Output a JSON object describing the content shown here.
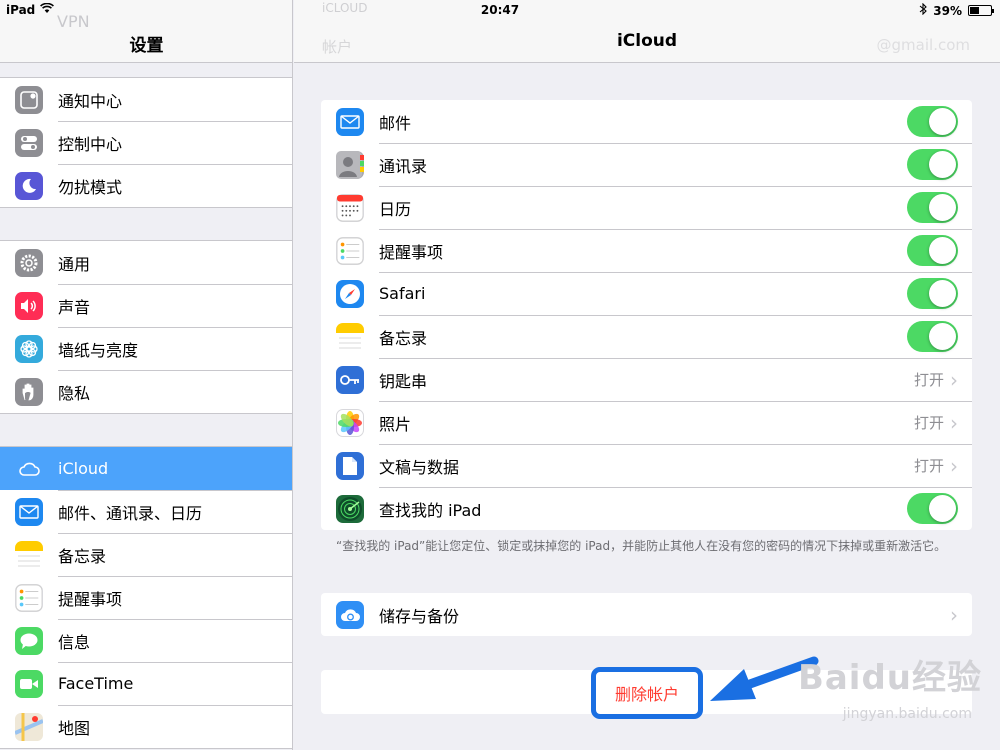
{
  "status_bar": {
    "device": "iPad",
    "time": "20:47",
    "battery": "39%",
    "battery_fraction": 0.39
  },
  "left_pane": {
    "title": "设置",
    "ghost_item": "VPN",
    "groups": [
      [
        {
          "label": "通知中心",
          "icon": "notification-center-icon",
          "color": "#8e8e93"
        },
        {
          "label": "控制中心",
          "icon": "control-center-icon",
          "color": "#8e8e93"
        },
        {
          "label": "勿扰模式",
          "icon": "moon-icon",
          "color": "#5856d6"
        }
      ],
      [
        {
          "label": "通用",
          "icon": "gear-icon",
          "color": "#8e8e93"
        },
        {
          "label": "声音",
          "icon": "speaker-icon",
          "color": "#ff2d55"
        },
        {
          "label": "墙纸与亮度",
          "icon": "flower-icon",
          "color": "#34aadc"
        },
        {
          "label": "隐私",
          "icon": "hand-icon",
          "color": "#8e8e93"
        }
      ],
      [
        {
          "label": "iCloud",
          "icon": "cloud-icon",
          "color": "#4ca3fb",
          "selected": true
        },
        {
          "label": "邮件、通讯录、日历",
          "icon": "mail-icon",
          "color": "#1e88f0"
        },
        {
          "label": "备忘录",
          "icon": "notes-icon",
          "color": "#ffcc00"
        },
        {
          "label": "提醒事项",
          "icon": "reminders-icon",
          "color": "#ffffff"
        },
        {
          "label": "信息",
          "icon": "messages-icon",
          "color": "#4cd964"
        },
        {
          "label": "FaceTime",
          "icon": "facetime-icon",
          "color": "#4cd964"
        },
        {
          "label": "地图",
          "icon": "maps-icon",
          "color": "#e8e2d2"
        }
      ]
    ]
  },
  "right_pane": {
    "title": "iCloud",
    "ghost_back": "iCLOUD",
    "ghost_account_label": "帐户",
    "ghost_account_value": "@gmail.com",
    "services": [
      {
        "label": "邮件",
        "icon": "mail-icon",
        "color": "#1e88f0",
        "toggle": true
      },
      {
        "label": "通讯录",
        "icon": "contacts-icon",
        "color": "#a9a9ae",
        "toggle": true
      },
      {
        "label": "日历",
        "icon": "calendar-icon",
        "color": "#ffffff",
        "toggle": true
      },
      {
        "label": "提醒事项",
        "icon": "reminders-icon",
        "color": "#ffffff",
        "toggle": true
      },
      {
        "label": "Safari",
        "icon": "compass-icon",
        "color": "#1e88f0",
        "toggle": true
      },
      {
        "label": "备忘录",
        "icon": "notes-icon",
        "color": "#ffcc00",
        "toggle": true
      },
      {
        "label": "钥匙串",
        "icon": "keychain-icon",
        "color": "#2f6fd6",
        "detail": "打开"
      },
      {
        "label": "照片",
        "icon": "photos-icon",
        "color": "#ffffff",
        "detail": "打开"
      },
      {
        "label": "文稿与数据",
        "icon": "document-icon",
        "color": "#2f6fd6",
        "detail": "打开"
      },
      {
        "label": "查找我的 iPad",
        "icon": "radar-icon",
        "color": "#1d6b3a",
        "toggle": true
      }
    ],
    "footnote": "“查找我的 iPad”能让您定位、锁定或抹掉您的 iPad，并能防止其他人在没有您的密码的情况下抹掉或重新激活它。",
    "storage": {
      "label": "储存与备份",
      "icon": "cloud-storage-icon",
      "color": "#2f8ff5"
    },
    "delete_account": "删除帐户"
  },
  "watermark": {
    "main": "Baidu经验",
    "sub": "jingyan.baidu.com"
  }
}
